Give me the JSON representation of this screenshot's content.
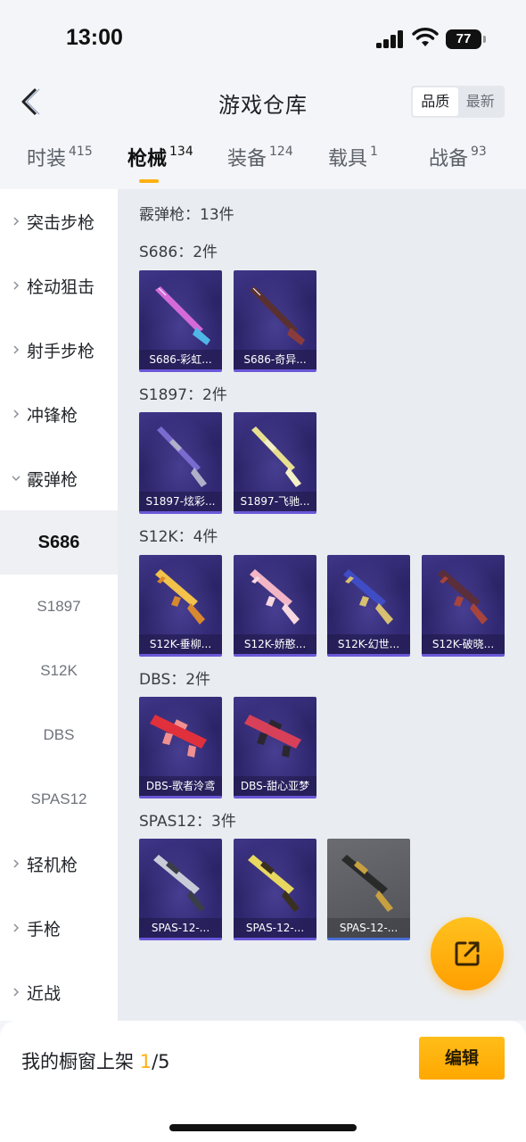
{
  "status_bar": {
    "time": "13:00",
    "battery": "77"
  },
  "header": {
    "title": "游戏仓库",
    "sort_options": [
      "品质",
      "最新"
    ],
    "sort_selected": "品质"
  },
  "tabs": [
    {
      "label": "时装",
      "count": "415",
      "active": false
    },
    {
      "label": "枪械",
      "count": "134",
      "active": true
    },
    {
      "label": "装备",
      "count": "124",
      "active": false
    },
    {
      "label": "载具",
      "count": "1",
      "active": false
    },
    {
      "label": "战备",
      "count": "93",
      "active": false
    }
  ],
  "sidebar": {
    "items": [
      {
        "label": "突击步枪",
        "type": "category",
        "expanded": false
      },
      {
        "label": "栓动狙击",
        "type": "category",
        "expanded": false
      },
      {
        "label": "射手步枪",
        "type": "category",
        "expanded": false
      },
      {
        "label": "冲锋枪",
        "type": "category",
        "expanded": false
      },
      {
        "label": "霰弹枪",
        "type": "category",
        "expanded": true
      },
      {
        "label": "S686",
        "type": "sub",
        "selected": true
      },
      {
        "label": "S1897",
        "type": "sub",
        "selected": false
      },
      {
        "label": "S12K",
        "type": "sub",
        "selected": false
      },
      {
        "label": "DBS",
        "type": "sub",
        "selected": false
      },
      {
        "label": "SPAS12",
        "type": "sub",
        "selected": false
      },
      {
        "label": "轻机枪",
        "type": "category",
        "expanded": false
      },
      {
        "label": "手枪",
        "type": "category",
        "expanded": false
      },
      {
        "label": "近战",
        "type": "category",
        "expanded": false
      }
    ]
  },
  "content": {
    "summary": "霰弹枪：13件",
    "groups": [
      {
        "label": "S686：2件",
        "items": [
          {
            "name": "S686-彩虹...",
            "style": "purple",
            "icon": "double-barrel-shotgun-icon"
          },
          {
            "name": "S686-奇异...",
            "style": "purple",
            "icon": "double-barrel-shotgun-icon"
          }
        ]
      },
      {
        "label": "S1897：2件",
        "items": [
          {
            "name": "S1897-炫彩...",
            "style": "purple",
            "icon": "pump-shotgun-icon"
          },
          {
            "name": "S1897-飞驰...",
            "style": "purple",
            "icon": "pump-shotgun-icon"
          }
        ]
      },
      {
        "label": "S12K：4件",
        "items": [
          {
            "name": "S12K-垂柳...",
            "style": "purple",
            "icon": "auto-shotgun-icon"
          },
          {
            "name": "S12K-娇憨...",
            "style": "purple",
            "icon": "auto-shotgun-icon"
          },
          {
            "name": "S12K-幻世...",
            "style": "purple",
            "icon": "auto-shotgun-icon"
          },
          {
            "name": "S12K-破晓...",
            "style": "purple",
            "icon": "auto-shotgun-icon"
          }
        ]
      },
      {
        "label": "DBS：2件",
        "items": [
          {
            "name": "DBS-歌者泠鸢",
            "style": "purple",
            "icon": "bullpup-shotgun-icon"
          },
          {
            "name": "DBS-甜心亚梦",
            "style": "purple",
            "icon": "bullpup-shotgun-icon"
          }
        ]
      },
      {
        "label": "SPAS12：3件",
        "items": [
          {
            "name": "SPAS-12-...",
            "style": "purple",
            "icon": "tactical-shotgun-icon"
          },
          {
            "name": "SPAS-12-...",
            "style": "purple",
            "icon": "tactical-shotgun-icon"
          },
          {
            "name": "SPAS-12-...",
            "style": "gray",
            "icon": "tactical-shotgun-icon"
          }
        ]
      }
    ]
  },
  "share_button": {
    "icon": "share-external-icon"
  },
  "bottom_bar": {
    "label": "我的橱窗上架",
    "current": "1",
    "total": "/5",
    "edit_label": "编辑"
  },
  "colors": {
    "accent": "#ffb012",
    "card_purple": "#2c2467",
    "card_gray": "#5a5c61"
  }
}
